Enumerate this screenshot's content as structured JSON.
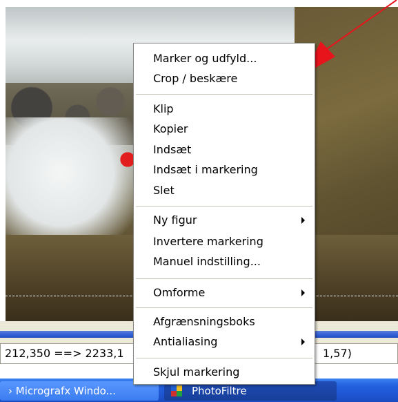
{
  "menu": {
    "group1": [
      "Marker og udfyld...",
      "Crop / beskære"
    ],
    "group2": [
      "Klip",
      "Kopier",
      "Indsæt",
      "Indsæt i markering",
      "Slet"
    ],
    "group3": [
      "Ny figur",
      "Invertere markering",
      "Manuel indstilling..."
    ],
    "group4": [
      "Omforme"
    ],
    "group5": [
      "Afgrænsningsboks",
      "Antialiasing"
    ],
    "group6": [
      "Skjul markering"
    ]
  },
  "status": {
    "left": "212,350 ==> 2233,1",
    "right": "1,57)"
  },
  "taskbar": {
    "item1": "Micrografx Windo...",
    "item2": "PhotoFiltre"
  },
  "colors": {
    "annotation_arrow": "#e8141c",
    "taskbar": "#2361e0",
    "status_strip": "#2f5fd6"
  }
}
